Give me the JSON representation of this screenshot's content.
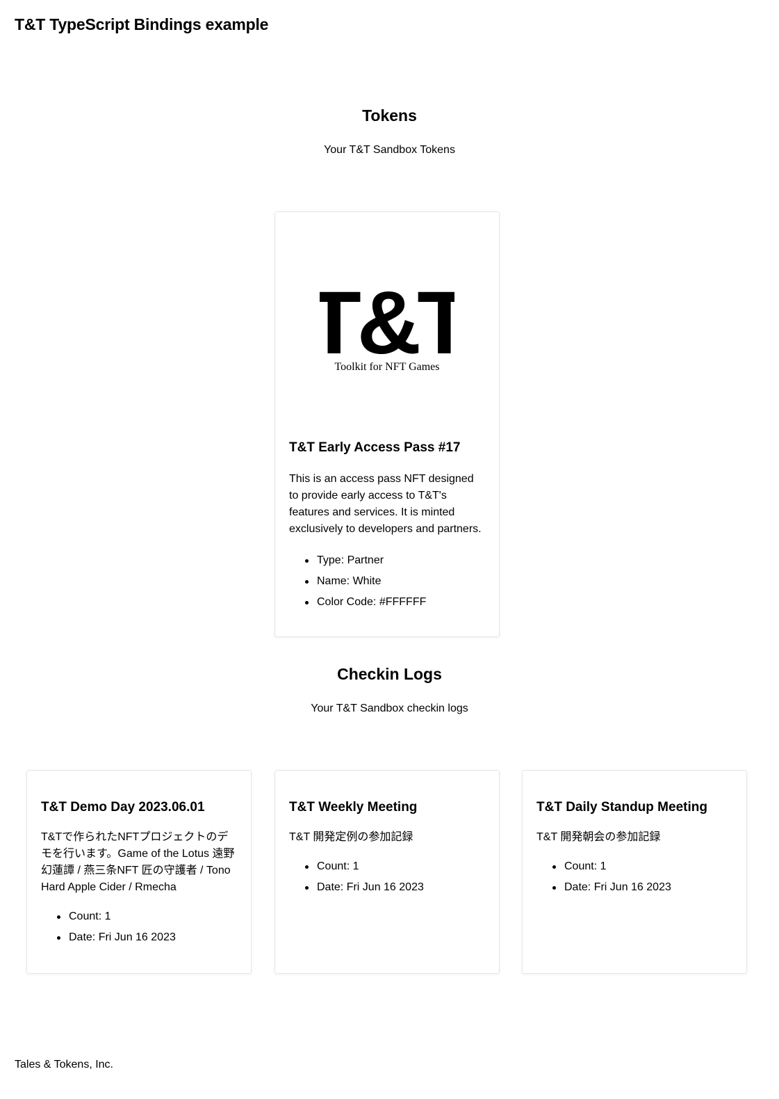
{
  "header": {
    "title": "T&T TypeScript Bindings example"
  },
  "tokens": {
    "title": "Tokens",
    "subtitle": "Your T&T Sandbox Tokens",
    "items": [
      {
        "logo": {
          "mark": "T&T",
          "tagline": "Toolkit for NFT Games"
        },
        "name": "T&T Early Access Pass #17",
        "description": "This is an access pass NFT designed to provide early access to T&T's features and services. It is minted exclusively to developers and partners.",
        "attributes": [
          "Type: Partner",
          "Name: White",
          "Color Code: #FFFFFF"
        ]
      }
    ]
  },
  "checkins": {
    "title": "Checkin Logs",
    "subtitle": "Your T&T Sandbox checkin logs",
    "items": [
      {
        "name": "T&T Demo Day 2023.06.01",
        "description": "T&Tで作られたNFTプロジェクトのデモを行います。Game of the Lotus 遠野幻蓮譚 / 燕三条NFT 匠の守護者 / Tono Hard Apple Cider / Rmecha",
        "attributes": [
          "Count: 1",
          "Date: Fri Jun 16 2023"
        ]
      },
      {
        "name": "T&T Weekly Meeting",
        "description": "T&T 開発定例の参加記録",
        "attributes": [
          "Count: 1",
          "Date: Fri Jun 16 2023"
        ]
      },
      {
        "name": "T&T Daily Standup Meeting",
        "description": "T&T 開発朝会の参加記録",
        "attributes": [
          "Count: 1",
          "Date: Fri Jun 16 2023"
        ]
      }
    ]
  },
  "footer": {
    "text": "Tales & Tokens, Inc."
  }
}
